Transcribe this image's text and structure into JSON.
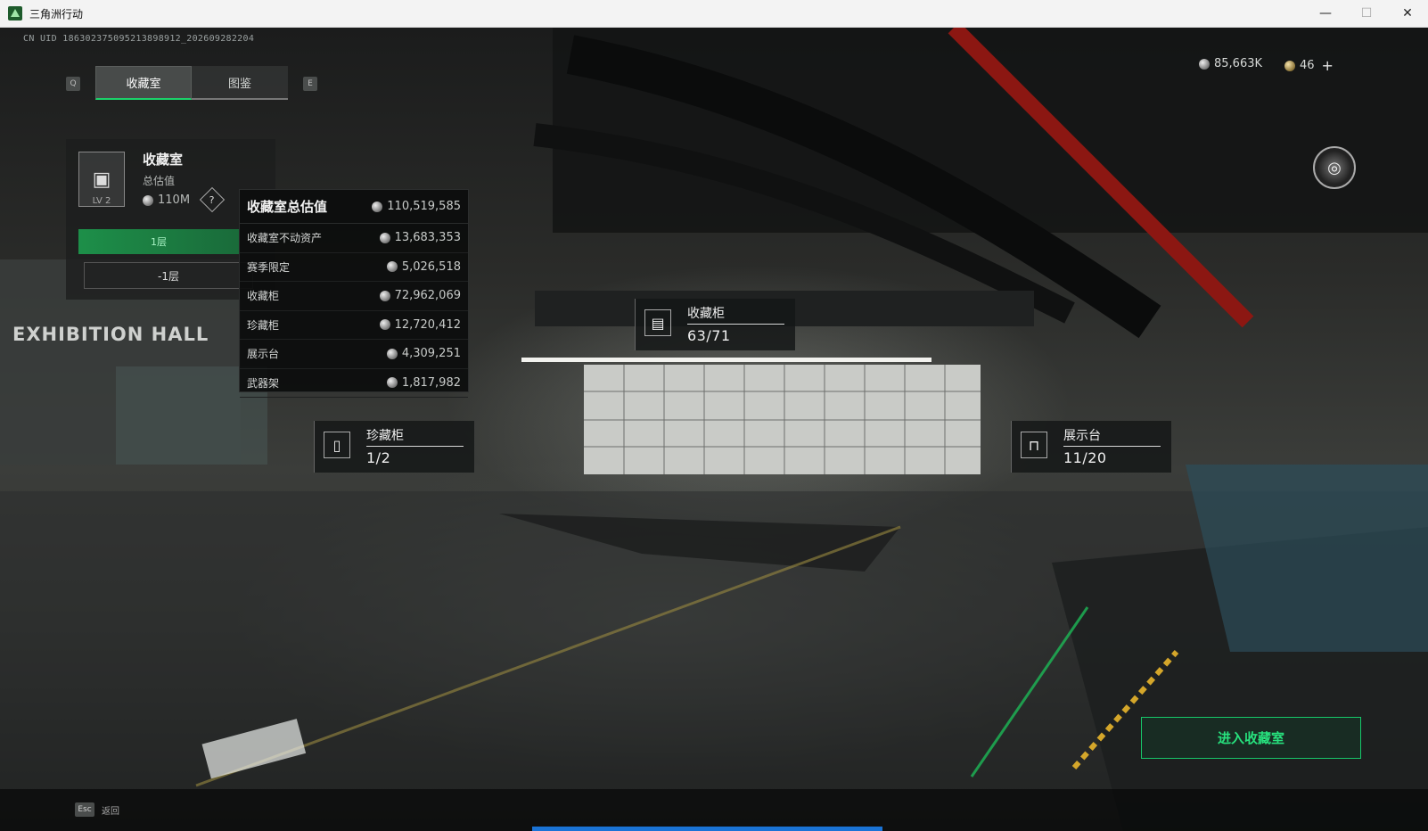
{
  "window": {
    "title": "三角洲行动",
    "minimize": "—",
    "maximize": "☐",
    "close": "✕"
  },
  "uid": "CN UID 1863023750952138989‌12_202609282204",
  "tabs": {
    "prev_key": "Q",
    "next_key": "E",
    "items": [
      {
        "label": "收藏室"
      },
      {
        "label": "图鉴"
      }
    ]
  },
  "currency": {
    "coins": "85,663K",
    "tokens": "46",
    "plus": "+"
  },
  "room": {
    "icon": "safe-icon",
    "level": "LV 2",
    "title": "收藏室",
    "subtitle": "总估值",
    "value": "110M",
    "help": "?",
    "floor_bar": "1层",
    "floor": "-1层"
  },
  "value_panel": {
    "title": "收藏室总估值",
    "total": "110,519,585",
    "rows": [
      {
        "label": "收藏室不动资产",
        "value": "13,683,353"
      },
      {
        "label": "赛季限定",
        "value": "5,026,518"
      },
      {
        "label": "收藏柜",
        "value": "72,962,069"
      },
      {
        "label": "珍藏柜",
        "value": "12,720,412"
      },
      {
        "label": "展示台",
        "value": "4,309,251"
      },
      {
        "label": "武器架",
        "value": "1,817,982"
      }
    ]
  },
  "markers": {
    "cabinet": {
      "name": "收藏柜",
      "count": "63/71",
      "icon": "cabinet-icon"
    },
    "rare": {
      "name": "珍藏柜",
      "count": "1/2",
      "icon": "rare-cabinet-icon"
    },
    "display": {
      "name": "展示台",
      "count": "11/20",
      "icon": "display-stand-icon"
    }
  },
  "sign": "EXHIBITION HALL",
  "enter_button": "进入收藏室",
  "footer": {
    "esc_key": "Esc",
    "back_label": "返回"
  },
  "colors": {
    "accent_green": "#1bd36a",
    "progress_blue": "#1a73d6"
  }
}
